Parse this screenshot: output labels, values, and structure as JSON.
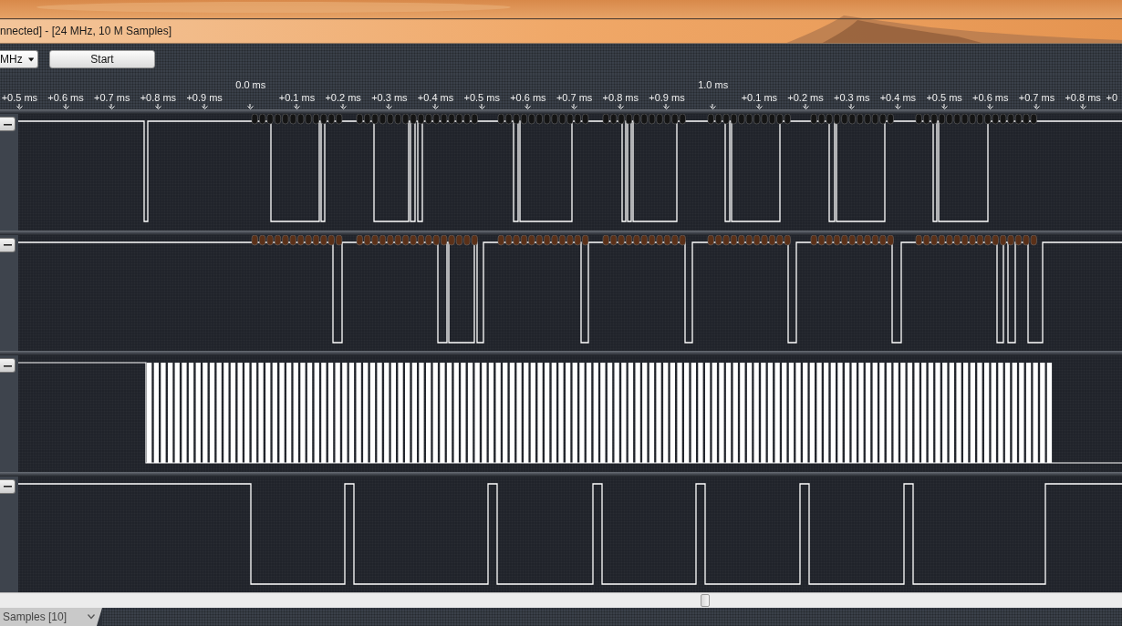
{
  "window": {
    "title": "nnected] - [24 MHz, 10 M Samples]"
  },
  "toolbar": {
    "rate_dropdown": {
      "value": "MHz"
    },
    "start_button": {
      "label": "Start"
    }
  },
  "timeline": {
    "ticks": [
      {
        "kind": "offset",
        "label": "+0.5 ms"
      },
      {
        "kind": "offset",
        "label": "+0.6 ms"
      },
      {
        "kind": "offset",
        "label": "+0.7 ms"
      },
      {
        "kind": "offset",
        "label": "+0.8 ms"
      },
      {
        "kind": "offset",
        "label": "+0.9 ms"
      },
      {
        "kind": "major",
        "label": "0.0 ms"
      },
      {
        "kind": "offset",
        "label": "+0.1 ms"
      },
      {
        "kind": "offset",
        "label": "+0.2 ms"
      },
      {
        "kind": "offset",
        "label": "+0.3 ms"
      },
      {
        "kind": "offset",
        "label": "+0.4 ms"
      },
      {
        "kind": "offset",
        "label": "+0.5 ms"
      },
      {
        "kind": "offset",
        "label": "+0.6 ms"
      },
      {
        "kind": "offset",
        "label": "+0.7 ms"
      },
      {
        "kind": "offset",
        "label": "+0.8 ms"
      },
      {
        "kind": "offset",
        "label": "+0.9 ms"
      },
      {
        "kind": "major",
        "label": "1.0 ms"
      },
      {
        "kind": "offset",
        "label": "+0.1 ms"
      },
      {
        "kind": "offset",
        "label": "+0.2 ms"
      },
      {
        "kind": "offset",
        "label": "+0.3 ms"
      },
      {
        "kind": "offset",
        "label": "+0.4 ms"
      },
      {
        "kind": "offset",
        "label": "+0.5 ms"
      },
      {
        "kind": "offset",
        "label": "+0.6 ms"
      },
      {
        "kind": "offset",
        "label": "+0.7 ms"
      },
      {
        "kind": "offset",
        "label": "+0.8 ms"
      },
      {
        "kind": "offset",
        "label": "+0"
      }
    ]
  },
  "channels": [
    {
      "expanded": true,
      "color": "#141414"
    },
    {
      "expanded": true,
      "color": "#5a3018"
    },
    {
      "expanded": true
    },
    {
      "expanded": true
    }
  ],
  "bottom_tab": {
    "label": "Samples [10]"
  }
}
